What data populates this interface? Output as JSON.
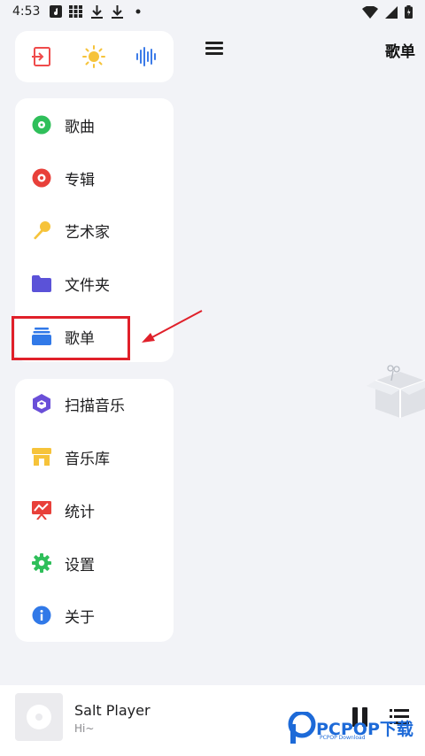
{
  "status_bar": {
    "time": "4:53"
  },
  "header": {
    "title": "歌单"
  },
  "drawer": {
    "quick_actions": [
      {
        "name": "exit-icon",
        "color": "#ef4b4b"
      },
      {
        "name": "sun-icon",
        "color": "#f6c33a"
      },
      {
        "name": "waveform-icon",
        "color": "#3c7be8"
      }
    ],
    "nav_primary": [
      {
        "label": "歌曲",
        "icon": "music-disc-icon",
        "color": "#2fbf5a"
      },
      {
        "label": "专辑",
        "icon": "album-icon",
        "color": "#e8403a"
      },
      {
        "label": "艺术家",
        "icon": "microphone-icon",
        "color": "#f6c33a"
      },
      {
        "label": "文件夹",
        "icon": "folder-icon",
        "color": "#5b52d8"
      },
      {
        "label": "歌单",
        "icon": "playlist-icon",
        "color": "#3179e8"
      }
    ],
    "nav_secondary": [
      {
        "label": "扫描音乐",
        "icon": "scan-cube-icon",
        "color": "#6a4fd8"
      },
      {
        "label": "音乐库",
        "icon": "store-icon",
        "color": "#f6c33a"
      },
      {
        "label": "统计",
        "icon": "chart-board-icon",
        "color": "#e8403a"
      },
      {
        "label": "设置",
        "icon": "gear-icon",
        "color": "#2fbf5a"
      },
      {
        "label": "关于",
        "icon": "info-icon",
        "color": "#3179e8"
      }
    ]
  },
  "player": {
    "title": "Salt Player",
    "artist": "Hi~"
  },
  "watermark": {
    "text": "PCPOP下载",
    "sub": "PCPOP Download"
  }
}
